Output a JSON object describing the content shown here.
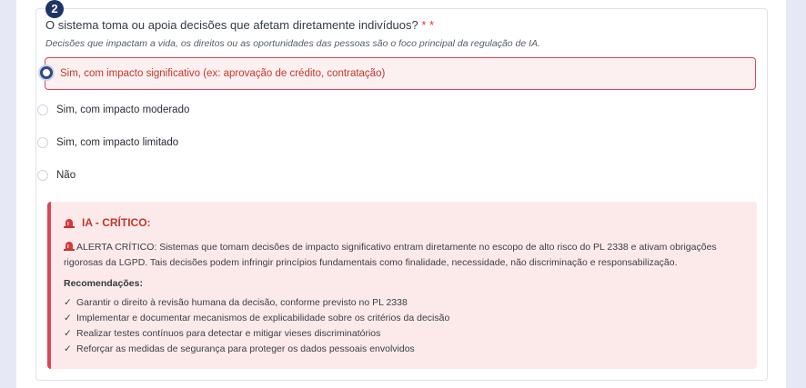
{
  "step": {
    "number": "2"
  },
  "question": {
    "text": "O sistema toma ou apoia decisões que afetam diretamente indivíduos?",
    "required_marks": "* *",
    "hint": "Decisões que impactam a vida, os direitos ou as oportunidades das pessoas são o foco principal da regulação de IA."
  },
  "options": [
    {
      "label": "Sim, com impacto significativo (ex: aprovação de crédito, contratação)",
      "selected": true
    },
    {
      "label": "Sim, com impacto moderado",
      "selected": false
    },
    {
      "label": "Sim, com impacto limitado",
      "selected": false
    },
    {
      "label": "Não",
      "selected": false
    }
  ],
  "alert": {
    "title": "IA - CRÍTICO:",
    "message": "ALERTA CRÍTICO: Sistemas que tomam decisões de impacto significativo entram diretamente no escopo de alto risco do PL 2338 e ativam obrigações rigorosas da LGPD. Tais decisões podem infringir princípios fundamentais como finalidade, necessidade, não discriminação e responsabilização.",
    "recommendations_title": "Recomendações:",
    "recommendations": [
      "Garantir o direito à revisão humana da decisão, conforme previsto no PL 2338",
      "Implementar e documentar mecanismos de explicabilidade sobre os critérios da decisão",
      "Realizar testes contínuos para detectar e mitigar vieses discriminatórios",
      "Reforçar as medidas de segurança para proteger os dados pessoais envolvidos"
    ],
    "check_symbol": "✓",
    "icon": "siren-icon"
  },
  "colors": {
    "accent": "#2c4a8a",
    "danger": "#c0392b",
    "danger_bg": "#fceaea",
    "badge": "#1f3366"
  }
}
